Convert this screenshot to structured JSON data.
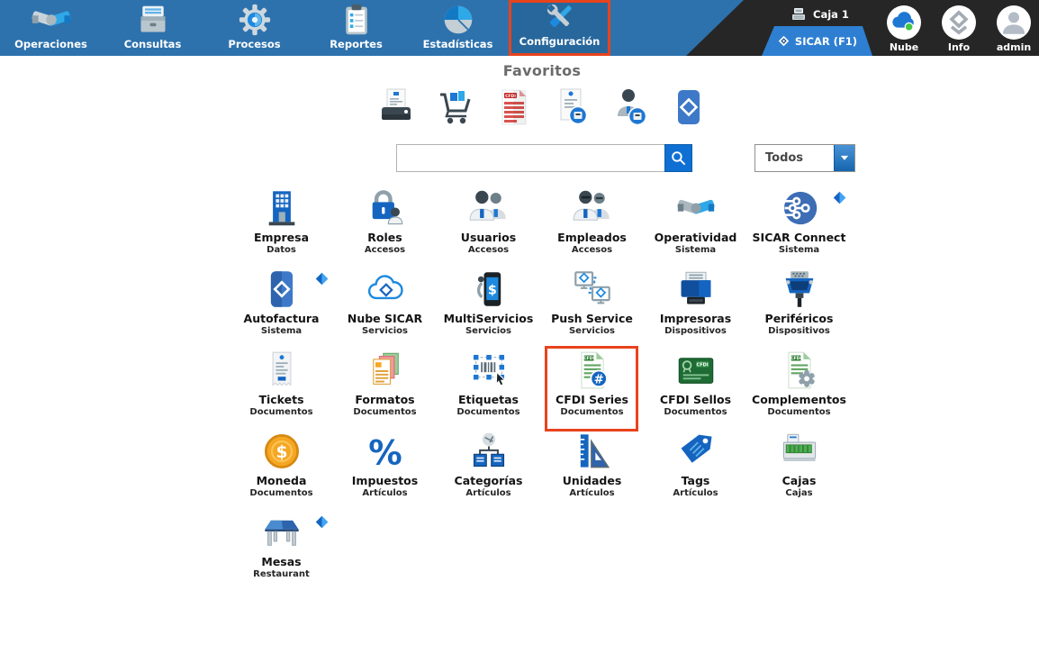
{
  "colors": {
    "topbar_blue": "#2d72ad",
    "selected_cell_blue": "#28679c",
    "highlight_red": "#e8431c",
    "dark_panel": "#262626",
    "ribbon_blue": "#2e7fd2",
    "search_button_blue": "#0f6fd2",
    "cloud_sync_green": "#43c643"
  },
  "topbar": {
    "menu_items": [
      {
        "label": "Operaciones",
        "icon": "handshake-icon",
        "selected": false
      },
      {
        "label": "Consultas",
        "icon": "archive-drawer-icon",
        "selected": false
      },
      {
        "label": "Procesos",
        "icon": "gear-icon",
        "selected": false
      },
      {
        "label": "Reportes",
        "icon": "clipboard-icon",
        "selected": false
      },
      {
        "label": "Estadísticas",
        "icon": "pie-chart-icon",
        "selected": false
      },
      {
        "label": "Configuración",
        "icon": "tools-icon",
        "selected": true
      }
    ],
    "station": {
      "label": "Caja 1",
      "icon": "cash-register-icon"
    },
    "ribbon": {
      "label": "SICAR (F1)",
      "icon": "diamond-icon"
    },
    "status_items": [
      {
        "label": "Nube",
        "icon": "cloud-status-icon"
      },
      {
        "label": "Info",
        "icon": "info-diamond-icon"
      },
      {
        "label": "admin",
        "icon": "user-avatar-icon"
      }
    ]
  },
  "favorites": {
    "title": "Favoritos",
    "items": [
      {
        "icon": "ticket-printer-icon"
      },
      {
        "icon": "shopping-cart-icon"
      },
      {
        "icon": "cfdi-document-icon"
      },
      {
        "icon": "receipt-badge-icon"
      },
      {
        "icon": "user-badge-icon"
      },
      {
        "icon": "sicar-card-icon"
      }
    ]
  },
  "search": {
    "value": "",
    "placeholder": "",
    "button_icon": "search-icon"
  },
  "filter": {
    "value": "Todos",
    "caret_icon": "caret-down-icon"
  },
  "grid": {
    "badge_icon": "diamond-badge-icon",
    "items": [
      {
        "label": "Empresa",
        "sublabel": "Datos",
        "icon": "building-icon"
      },
      {
        "label": "Roles",
        "sublabel": "Accesos",
        "icon": "lock-user-icon"
      },
      {
        "label": "Usuarios",
        "sublabel": "Accesos",
        "icon": "users-icon"
      },
      {
        "label": "Empleados",
        "sublabel": "Accesos",
        "icon": "employees-icon"
      },
      {
        "label": "Operatividad",
        "sublabel": "Sistema",
        "icon": "handshake-blue-icon"
      },
      {
        "label": "SICAR Connect",
        "sublabel": "Sistema",
        "icon": "connect-icon",
        "badge": true
      },
      {
        "label": "Autofactura",
        "sublabel": "Sistema",
        "icon": "autofactura-card-icon",
        "badge": true
      },
      {
        "label": "Nube SICAR",
        "sublabel": "Servicios",
        "icon": "cloud-diamond-icon"
      },
      {
        "label": "MultiServicios",
        "sublabel": "Servicios",
        "icon": "phone-dollar-icon"
      },
      {
        "label": "Push Service",
        "sublabel": "Servicios",
        "icon": "monitors-sync-icon"
      },
      {
        "label": "Impresoras",
        "sublabel": "Dispositivos",
        "icon": "printer-icon"
      },
      {
        "label": "Periféricos",
        "sublabel": "Dispositivos",
        "icon": "vga-connector-icon"
      },
      {
        "label": "Tickets",
        "sublabel": "Documentos",
        "icon": "receipt-icon"
      },
      {
        "label": "Formatos",
        "sublabel": "Documentos",
        "icon": "documents-stack-icon"
      },
      {
        "label": "Etiquetas",
        "sublabel": "Documentos",
        "icon": "barcode-label-icon"
      },
      {
        "label": "CFDI Series",
        "sublabel": "Documentos",
        "icon": "cfdi-series-icon",
        "highlighted": true
      },
      {
        "label": "CFDI Sellos",
        "sublabel": "Documentos",
        "icon": "cfdi-stamp-icon"
      },
      {
        "label": "Complementos",
        "sublabel": "Documentos",
        "icon": "document-gear-icon"
      },
      {
        "label": "Moneda",
        "sublabel": "Documentos",
        "icon": "coin-icon"
      },
      {
        "label": "Impuestos",
        "sublabel": "Artículos",
        "icon": "percent-icon"
      },
      {
        "label": "Categorías",
        "sublabel": "Artículos",
        "icon": "category-tree-icon"
      },
      {
        "label": "Unidades",
        "sublabel": "Artículos",
        "icon": "ruler-triangle-icon"
      },
      {
        "label": "Tags",
        "sublabel": "Artículos",
        "icon": "price-tag-icon"
      },
      {
        "label": "Cajas",
        "sublabel": "Cajas",
        "icon": "cash-drawer-icon"
      },
      {
        "label": "Mesas",
        "sublabel": "Restaurant",
        "icon": "table-icon",
        "badge": true
      }
    ]
  }
}
